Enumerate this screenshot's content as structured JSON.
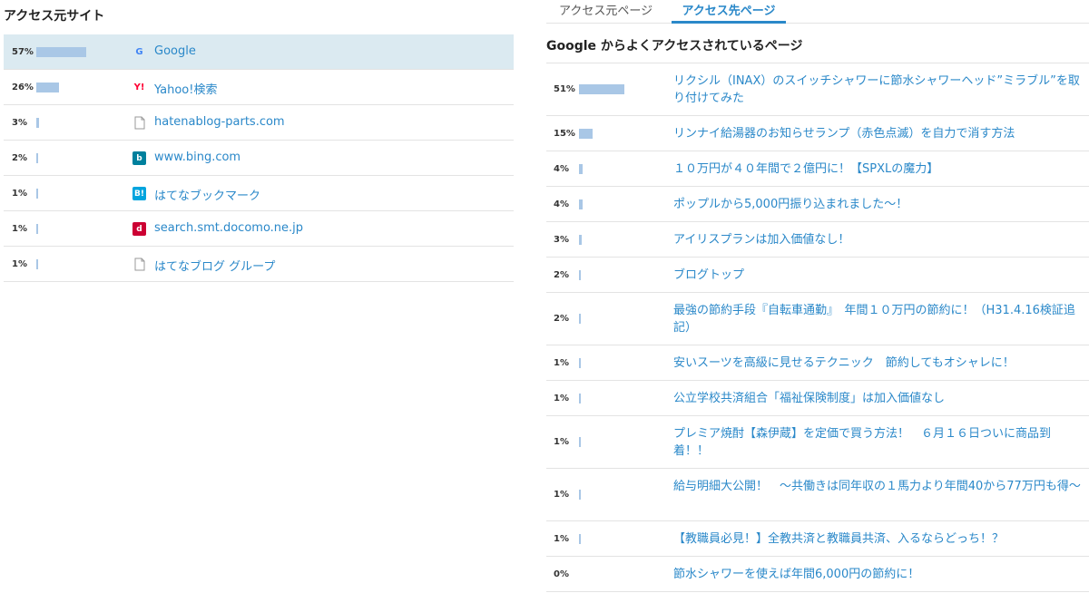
{
  "left": {
    "title": "アクセス元サイト",
    "sources": [
      {
        "pct": "57%",
        "value": 57,
        "icon": "google-icon",
        "icon_glyph": "G",
        "icon_color": "#4285f4",
        "label": "Google",
        "active": true
      },
      {
        "pct": "26%",
        "value": 26,
        "icon": "yahoo-icon",
        "icon_glyph": "Y!",
        "icon_color": "#ff0033",
        "label": "Yahoo!検索",
        "active": false
      },
      {
        "pct": "3%",
        "value": 3,
        "icon": "page-icon",
        "icon_glyph": "",
        "icon_color": "#999999",
        "label": "hatenablog-parts.com",
        "active": false
      },
      {
        "pct": "2%",
        "value": 2,
        "icon": "bing-icon",
        "icon_glyph": "b",
        "icon_color": "#00809d",
        "label": "www.bing.com",
        "active": false
      },
      {
        "pct": "1%",
        "value": 1,
        "icon": "hatena-bookmark-icon",
        "icon_glyph": "B!",
        "icon_color": "#00a4de",
        "label": "はてなブックマーク",
        "active": false
      },
      {
        "pct": "1%",
        "value": 1,
        "icon": "docomo-icon",
        "icon_glyph": "d",
        "icon_color": "#cc0033",
        "label": "search.smt.docomo.ne.jp",
        "active": false
      },
      {
        "pct": "1%",
        "value": 1,
        "icon": "page-icon",
        "icon_glyph": "",
        "icon_color": "#999999",
        "label": "はてなブログ グループ",
        "active": false
      }
    ]
  },
  "right": {
    "tabs": [
      {
        "label": "アクセス元ページ",
        "active": false
      },
      {
        "label": "アクセス先ページ",
        "active": true
      }
    ],
    "heading": "Google からよくアクセスされているページ",
    "pages": [
      {
        "pct": "51%",
        "value": 51,
        "label": "リクシル（INAX）のスイッチシャワーに節水シャワーヘッド”ミラブル”を取り付けてみた",
        "lines": 2
      },
      {
        "pct": "15%",
        "value": 15,
        "label": "リンナイ給湯器のお知らせランプ（赤色点滅）を自力で消す方法",
        "lines": 1
      },
      {
        "pct": "4%",
        "value": 4,
        "label": "１０万円が４０年間で２億円に！【SPXLの魔力】",
        "lines": 1
      },
      {
        "pct": "4%",
        "value": 4,
        "label": "ポップルから5,000円振り込まれました～！",
        "lines": 1
      },
      {
        "pct": "3%",
        "value": 3,
        "label": "アイリスプランは加入価値なし！",
        "lines": 1
      },
      {
        "pct": "2%",
        "value": 2,
        "label": "ブログトップ",
        "lines": 1
      },
      {
        "pct": "2%",
        "value": 2,
        "label": "最強の節約手段『自転車通勤』　年間１０万円の節約に！（H31.4.16検証追記）",
        "lines": 2
      },
      {
        "pct": "1%",
        "value": 1,
        "label": "安いスーツを高級に見せるテクニック　節約してもオシャレに！",
        "lines": 1
      },
      {
        "pct": "1%",
        "value": 1,
        "label": "公立学校共済組合「福祉保険制度」は加入価値なし",
        "lines": 1
      },
      {
        "pct": "1%",
        "value": 1,
        "label": "プレミア焼酎【森伊蔵】を定価で買う方法！　６月１６日ついに商品到着！！",
        "lines": 2
      },
      {
        "pct": "1%",
        "value": 1,
        "label": "給与明細大公開！　～共働きは同年収の１馬力より年間40から77万円も得～",
        "lines": 2
      },
      {
        "pct": "1%",
        "value": 1,
        "label": "【教職員必見！】全教共済と教職員共済、入るならどっち！？",
        "lines": 1
      },
      {
        "pct": "0%",
        "value": 0,
        "label": "節水シャワーを使えば年間6,000円の節約に！",
        "lines": 1
      }
    ]
  }
}
